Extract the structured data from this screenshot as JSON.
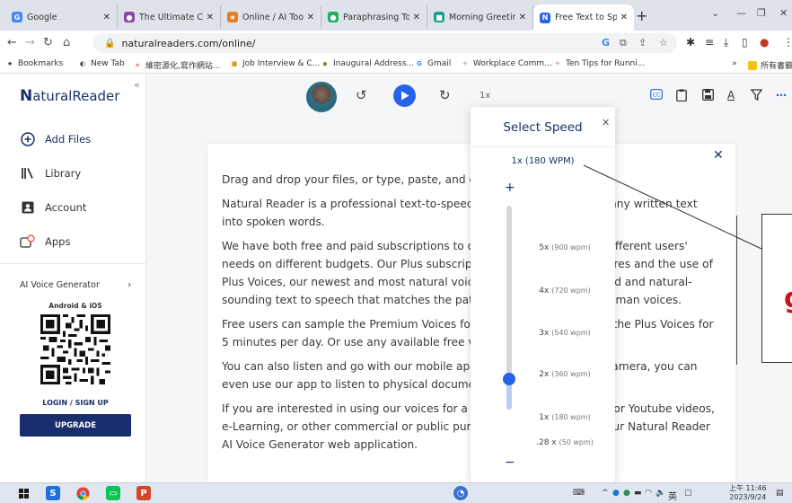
{
  "browser": {
    "tabs": [
      {
        "title": "Google",
        "icon": "G",
        "color": "#4285f4"
      },
      {
        "title": "The Ultimate Cha",
        "icon": "●",
        "color": "#8e44ad"
      },
      {
        "title": "Online / AI Tools",
        "icon": "★",
        "color": "#e67e22"
      },
      {
        "title": "Paraphrasing Too",
        "icon": "●",
        "color": "#27ae60"
      },
      {
        "title": "Morning Greeting",
        "icon": "■",
        "color": "#16a085"
      },
      {
        "title": "Free Text to Spee",
        "icon": "N",
        "color": "#2563eb"
      }
    ],
    "url": "naturalreaders.com/online/",
    "bookmarks": [
      {
        "label": "Bookmarks",
        "icon": "★",
        "color": "#333"
      },
      {
        "label": "New Tab",
        "icon": "◐",
        "color": "#333"
      },
      {
        "label": "維密源化,寫作網站...",
        "icon": "✶",
        "color": "#e74c3c"
      },
      {
        "label": "Job Interview & C...",
        "icon": "■",
        "color": "#d4a017"
      },
      {
        "label": "Inaugural Address...",
        "icon": "◆",
        "color": "#6b8e23"
      },
      {
        "label": "Gmail",
        "icon": "G",
        "color": "#4285f4"
      },
      {
        "label": "Workplace Comm...",
        "icon": "✧",
        "color": "#c0392b"
      },
      {
        "label": "Ten Tips for Runni...",
        "icon": "✧",
        "color": "#c0392b"
      }
    ],
    "other_bookmarks": "所有書籤"
  },
  "sidebar": {
    "logo_mark": "N",
    "logo_text": "aturalReader",
    "nav": [
      {
        "label": "Add Files"
      },
      {
        "label": "Library"
      },
      {
        "label": "Account"
      },
      {
        "label": "Apps"
      }
    ],
    "voice_generator": "AI Voice Generator",
    "platforms": "Android & iOS",
    "login": "LOGIN / SIGN UP",
    "upgrade": "UPGRADE"
  },
  "player": {
    "speed_label": "1x"
  },
  "document": {
    "paragraphs": [
      "Drag and drop your files, or type, paste, and edit text here.",
      "Natural Reader is a professional text-to-speech program that converts any written text into spoken words.",
      "We have both free and paid subscriptions to our applications to meet different users' needs on different budgets. Our Plus subscriptions offer exclusive features and the use of Plus Voices, our newest and most natural voices. Plus Voices enable fluid and natural-sounding text to speech that matches the patterns and intonation of human voices.",
      "Free users can sample the Premium Voices for 20 minutes per day and the Plus Voices for 5 minutes per day. Or use any available free voices unlimitedly.",
      "You can also listen and go with our mobile apps, and using the phone camera, you can even use our app to listen to physical documents.",
      "If you are interested in using our voices for a commercial use, such as for Youtube videos, e-Learning, or other commercial or public purposes, please check out our Natural Reader AI Voice Generator web application."
    ]
  },
  "speed_popup": {
    "title": "Select Speed",
    "current": "1x (180 WPM)",
    "plus": "+",
    "minus": "−",
    "options": [
      {
        "rate": "5x",
        "wpm": "(900 wpm)"
      },
      {
        "rate": "4x",
        "wpm": "(720 wpm)"
      },
      {
        "rate": "3x",
        "wpm": "(540 wpm)"
      },
      {
        "rate": "2x",
        "wpm": "(360 wpm)"
      },
      {
        "rate": "1x",
        "wpm": "(180 wpm)"
      },
      {
        "rate": ".28 x",
        "wpm": "(50 wpm)"
      }
    ],
    "selected_index": 4
  },
  "overlay": {
    "glyph": "g"
  },
  "taskbar": {
    "clock_time": "上午 11:46",
    "clock_date": "2023/9/24",
    "ime": "英"
  },
  "colors": {
    "accent": "#2563eb",
    "brand_dark": "#1c2f6b",
    "upgrade_bg": "#1a2e6e"
  }
}
